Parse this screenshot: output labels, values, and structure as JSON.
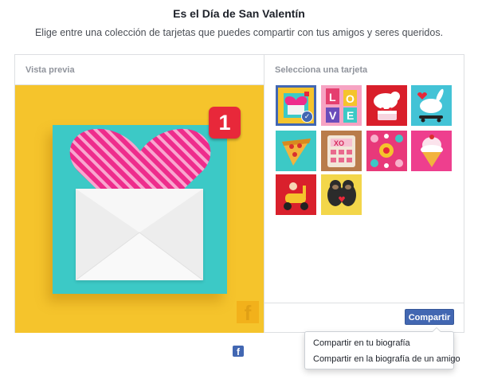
{
  "header": {
    "title": "Es el Día de San Valentín",
    "subtitle": "Elige entre una colección de tarjetas que puedes compartir con tus amigos y seres queridos."
  },
  "preview": {
    "label": "Vista previa",
    "badge_count": "1"
  },
  "selector": {
    "label": "Selecciona una tarjeta",
    "cards": [
      {
        "name": "card-envelope-heart",
        "selected": true
      },
      {
        "name": "card-love-letters"
      },
      {
        "name": "card-cat-cake"
      },
      {
        "name": "card-bunny-skateboard"
      },
      {
        "name": "card-pizza-hearts"
      },
      {
        "name": "card-xo-calculator"
      },
      {
        "name": "card-floral-pattern"
      },
      {
        "name": "card-ice-cream"
      },
      {
        "name": "card-scooter"
      },
      {
        "name": "card-gorillas"
      }
    ]
  },
  "actions": {
    "share_label": "Compartir",
    "menu": [
      "Compartir en tu biografía",
      "Compartir en la biografía de un amigo"
    ]
  },
  "colors": {
    "accent": "#4267b2",
    "preview_background": "#f5c42c",
    "card_teal": "#3cc9c6",
    "heart_pink": "#ee2c8c",
    "badge_red": "#e8283a"
  },
  "icons": {
    "watermark": "facebook-icon",
    "footer": "facebook-icon",
    "selected": "check-icon"
  }
}
